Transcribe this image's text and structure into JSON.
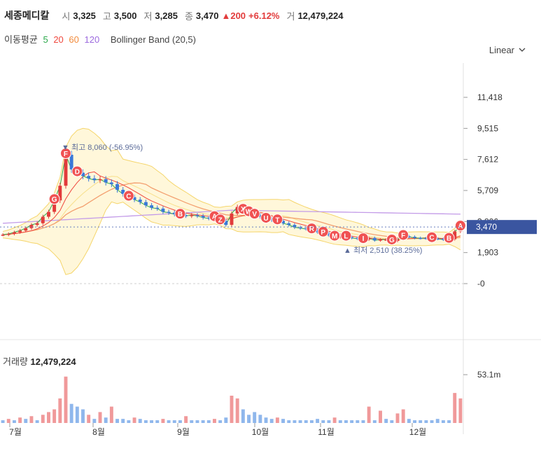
{
  "header": {
    "name": "세종메디칼",
    "open_label": "시",
    "open": "3,325",
    "high_label": "고",
    "high": "3,500",
    "low_label": "저",
    "low": "3,285",
    "close_label": "종",
    "close": "3,470",
    "change": "▲200",
    "change_pct": "+6.12%",
    "volume_label": "거",
    "volume": "12,479,224"
  },
  "indicators": {
    "ma_label": "이동평균",
    "ma_periods": [
      "5",
      "20",
      "60",
      "120"
    ],
    "ma_colors": [
      "#2ba84a",
      "#f0483e",
      "#f28b3c",
      "#9c6ade"
    ],
    "bollinger_label": "Bollinger Band (20,5)"
  },
  "scale_toggle": {
    "label": "Linear",
    "icon": "chevron-down-icon"
  },
  "chart_data": {
    "type": "candlestick",
    "y_ticks": [
      "11,418",
      "9,515",
      "7,612",
      "5,709",
      "3,806",
      "1,903",
      "-0"
    ],
    "y_tick_values": [
      11418,
      9515,
      7612,
      5709,
      3806,
      1903,
      0
    ],
    "ylim": [
      0,
      12500
    ],
    "x_ticks": [
      "7월",
      "8월",
      "9월",
      "10월",
      "11월",
      "12월"
    ],
    "current_price_label": "3,470",
    "current_price": 3470,
    "high_annotation": "최고 8,060 (-56.95%)",
    "high_value": 8060,
    "low_annotation": "최저 2,510 (38.25%)",
    "low_value": 2510,
    "close": [
      3000,
      3050,
      3150,
      3250,
      3400,
      3600,
      3700,
      4100,
      4400,
      5100,
      6000,
      7900,
      7000,
      6800,
      6600,
      6450,
      6350,
      6400,
      6200,
      6100,
      5750,
      5500,
      5300,
      5150,
      5000,
      4800,
      4650,
      4600,
      4400,
      4350,
      4250,
      4200,
      4150,
      4200,
      4150,
      4050,
      4000,
      4050,
      3850,
      3600,
      4300,
      4700,
      4500,
      4350,
      4200,
      4100,
      3950,
      3900,
      3850,
      3700,
      3600,
      3450,
      3400,
      3350,
      3300,
      3150,
      3100,
      2950,
      2850,
      2900,
      2850,
      2800,
      2750,
      2700,
      2800,
      2650,
      2700,
      2700,
      2620,
      2720,
      2900,
      2870,
      2800,
      2790,
      2780,
      2760,
      2750,
      2700,
      2720,
      3200,
      3470
    ],
    "events": [
      "G",
      "F",
      "D",
      "C",
      "B",
      "A",
      "Z",
      "X",
      "W",
      "V",
      "U",
      "T",
      "R",
      "P",
      "M",
      "L",
      "I",
      "G",
      "F",
      "C",
      "B",
      "A"
    ],
    "volume_title": "거래량",
    "volume_value": "12,479,224",
    "volume_axis_label": "53.1m",
    "volume_max": 53.1,
    "volume_up": [
      false,
      true,
      false,
      true,
      false,
      true,
      false,
      true,
      true,
      true,
      true,
      true,
      false,
      false,
      false,
      true,
      false,
      true,
      false,
      true,
      false,
      false,
      false,
      true,
      false,
      false,
      false,
      false,
      true,
      false,
      false,
      false,
      true,
      false,
      false,
      false,
      false,
      true,
      false,
      false,
      true,
      true,
      false,
      false,
      false,
      false,
      false,
      false,
      true,
      false,
      false,
      false,
      false,
      false,
      false,
      false,
      false,
      false,
      true,
      false,
      false,
      false,
      false,
      false,
      true,
      false,
      true,
      false,
      false,
      true,
      true,
      false,
      false,
      false,
      false,
      false,
      false,
      false,
      false,
      true,
      true
    ],
    "volume_m": [
      2,
      3,
      2,
      4,
      3,
      5,
      2,
      6,
      8,
      10,
      18,
      34,
      14,
      12,
      10,
      6,
      3,
      8,
      4,
      12,
      3,
      3,
      2,
      4,
      3,
      2,
      2,
      2,
      3,
      2,
      2,
      2,
      5,
      2,
      2,
      2,
      2,
      3,
      2,
      4,
      20,
      18,
      10,
      6,
      8,
      6,
      4,
      3,
      4,
      3,
      2,
      2,
      2,
      2,
      2,
      3,
      2,
      2,
      4,
      2,
      2,
      2,
      2,
      2,
      12,
      2,
      9,
      3,
      2,
      7,
      10,
      3,
      2,
      2,
      2,
      2,
      3,
      2,
      2,
      22,
      18
    ]
  }
}
